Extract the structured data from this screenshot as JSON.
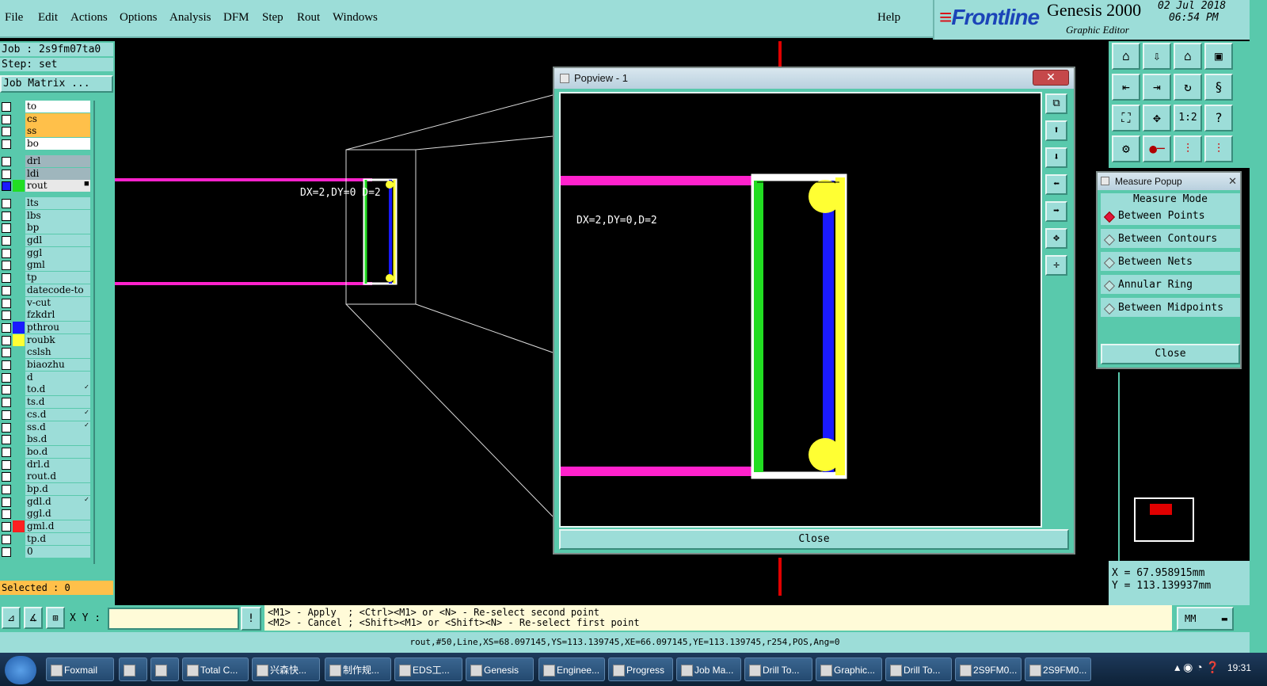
{
  "menu": [
    "File",
    "Edit",
    "Actions",
    "Options",
    "Analysis",
    "DFM",
    "Step",
    "Rout",
    "Windows"
  ],
  "help": "Help",
  "brand": {
    "name": "Frontline",
    "product": "Genesis 2000",
    "subtitle": "Graphic Editor",
    "date": "02 Jul 2018",
    "time": "06:54 PM"
  },
  "job": {
    "job_line": "Job : 2s9fm07ta0",
    "step_line": "Step: set",
    "matrix_button": "Job Matrix ..."
  },
  "layers": [
    {
      "name": "to",
      "bg": "#ffffff",
      "swatch": ""
    },
    {
      "name": "cs",
      "bg": "#ffc04a",
      "swatch": ""
    },
    {
      "name": "ss",
      "bg": "#ffc04a",
      "swatch": ""
    },
    {
      "name": "bo",
      "bg": "#ffffff",
      "swatch": ""
    },
    {
      "name": "drl",
      "bg": "#9fb6bd",
      "swatch": ""
    },
    {
      "name": "ldi",
      "bg": "#9fb6bd",
      "swatch": ""
    },
    {
      "name": "rout",
      "bg": "#e8e8e8",
      "swatch": "#22dd22",
      "checked": true,
      "mark": "■"
    },
    {
      "name": "lts",
      "bg": "#9cddd8",
      "swatch": ""
    },
    {
      "name": "lbs",
      "bg": "#9cddd8",
      "swatch": ""
    },
    {
      "name": "bp",
      "bg": "#9cddd8",
      "swatch": ""
    },
    {
      "name": "gdl",
      "bg": "#9cddd8",
      "swatch": ""
    },
    {
      "name": "ggl",
      "bg": "#9cddd8",
      "swatch": ""
    },
    {
      "name": "gml",
      "bg": "#9cddd8",
      "swatch": ""
    },
    {
      "name": "tp",
      "bg": "#9cddd8",
      "swatch": ""
    },
    {
      "name": "datecode-to",
      "bg": "#9cddd8",
      "swatch": ""
    },
    {
      "name": "v-cut",
      "bg": "#9cddd8",
      "swatch": ""
    },
    {
      "name": "fzkdrl",
      "bg": "#9cddd8",
      "swatch": ""
    },
    {
      "name": "pthrou",
      "bg": "#9cddd8",
      "swatch": "#1a1aff"
    },
    {
      "name": "roubk",
      "bg": "#9cddd8",
      "swatch": "#ffff33"
    },
    {
      "name": "cslsh",
      "bg": "#9cddd8",
      "swatch": ""
    },
    {
      "name": "biaozhu",
      "bg": "#9cddd8",
      "swatch": ""
    },
    {
      "name": "d",
      "bg": "#9cddd8",
      "swatch": ""
    },
    {
      "name": "to.d",
      "bg": "#9cddd8",
      "swatch": "",
      "mark": "✓"
    },
    {
      "name": "ts.d",
      "bg": "#9cddd8",
      "swatch": ""
    },
    {
      "name": "cs.d",
      "bg": "#9cddd8",
      "swatch": "",
      "mark": "✓"
    },
    {
      "name": "ss.d",
      "bg": "#9cddd8",
      "swatch": "",
      "mark": "✓"
    },
    {
      "name": "bs.d",
      "bg": "#9cddd8",
      "swatch": ""
    },
    {
      "name": "bo.d",
      "bg": "#9cddd8",
      "swatch": ""
    },
    {
      "name": "drl.d",
      "bg": "#9cddd8",
      "swatch": ""
    },
    {
      "name": "rout.d",
      "bg": "#9cddd8",
      "swatch": ""
    },
    {
      "name": "bp.d",
      "bg": "#9cddd8",
      "swatch": ""
    },
    {
      "name": "gdl.d",
      "bg": "#9cddd8",
      "swatch": "",
      "mark": "✓"
    },
    {
      "name": "ggl.d",
      "bg": "#9cddd8",
      "swatch": ""
    },
    {
      "name": "gml.d",
      "bg": "#9cddd8",
      "swatch": "#ff2020"
    },
    {
      "name": "tp.d",
      "bg": "#9cddd8",
      "swatch": ""
    },
    {
      "name": "0",
      "bg": "#9cddd8",
      "swatch": ""
    }
  ],
  "selected": "Selected : 0",
  "canvas": {
    "measure_label": "DX=2,DY=0 D=2"
  },
  "popview": {
    "title": "Popview - 1",
    "measure_label": "DX=2,DY=0,D=2",
    "close": "Close",
    "close_x": "✕"
  },
  "measure": {
    "title": "Measure Popup",
    "header": "Measure Mode",
    "options": [
      "Between Points",
      "Between Contours",
      "Between Nets",
      "Annular Ring",
      "Between Midpoints"
    ],
    "selected_option": "Between Points",
    "close": "Close"
  },
  "coords": {
    "x": "X =  67.958915mm",
    "y": "Y = 113.139937mm"
  },
  "command": {
    "xy_label": "X Y :",
    "xy_value": "",
    "help_line1": "<M1> - Apply  ; <Ctrl><M1> or <N> - Re-select second point",
    "help_line2": "<M2> - Cancel ; <Shift><M1> or <Shift><N> - Re-select first point",
    "units": "MM"
  },
  "status": "rout,#50,Line,XS=68.097145,YS=113.139745,XE=66.097145,YE=113.139745,r254,POS,Ang=0",
  "taskbar": {
    "items": [
      "Foxmail",
      "",
      "",
      "Total C...",
      "兴森快...",
      "制作规...",
      "EDS工...",
      "Genesis",
      "Enginee...",
      "Progress",
      "Job Ma...",
      "Drill To...",
      "Graphic...",
      "Drill To...",
      "2S9FM0...",
      "2S9FM0..."
    ],
    "clock": "19:31"
  },
  "colors": {
    "accent_teal": "#59c9ac",
    "panel_light": "#9cddd8",
    "magenta": "#ff22cc",
    "green": "#22dd22",
    "blue": "#1a1aff",
    "yellow": "#ffff33",
    "red": "#e00000"
  }
}
